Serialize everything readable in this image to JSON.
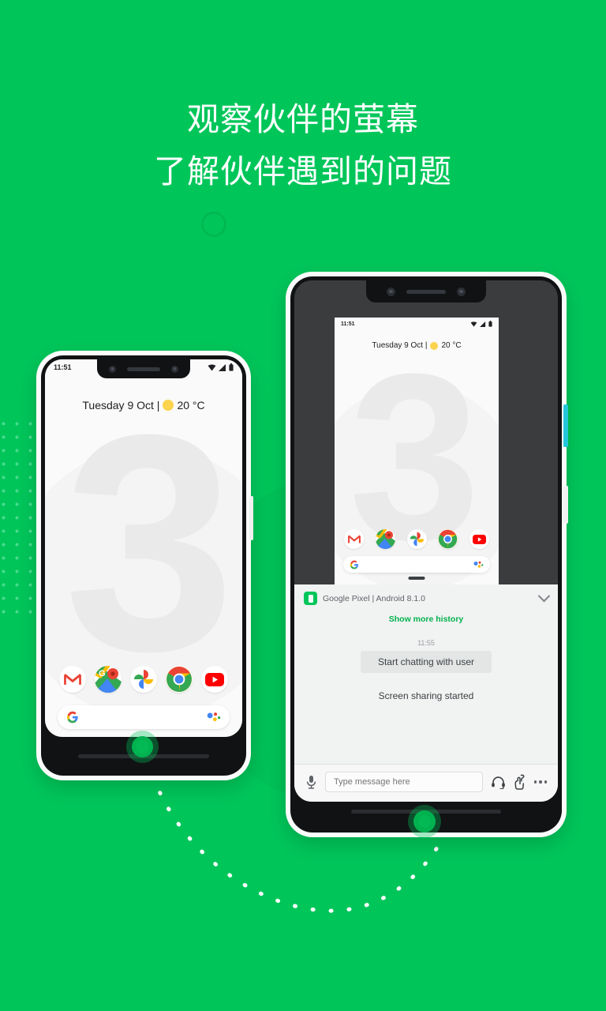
{
  "theme": {
    "background": "#00c65a",
    "accent_green": "#00b24d",
    "headline_color": "#ffffff",
    "phone_body": "#fbfbfb",
    "screen_bg": "#fafafa",
    "dark_screen": "#3a3c3e"
  },
  "headline": {
    "line1": "观察伙伴的萤幕",
    "line2": "了解伙伴遇到的问题",
    "full": "观察伙伴的萤幕\n了解伙伴遇到的问题"
  },
  "left_phone": {
    "label": "user-device",
    "status_bar": {
      "time": "11:51",
      "icons": [
        "wifi-icon",
        "signal-icon",
        "battery-icon"
      ]
    },
    "home": {
      "date_weather": "Tuesday 9 Oct |",
      "temperature": "20 °C",
      "weather_icon": "sun-icon",
      "wallpaper_glyph": "3"
    },
    "dock": [
      {
        "name": "gmail",
        "label": "Gmail"
      },
      {
        "name": "maps",
        "label": "Maps"
      },
      {
        "name": "photos",
        "label": "Photos"
      },
      {
        "name": "chrome",
        "label": "Chrome"
      },
      {
        "name": "youtube",
        "label": "YouTube"
      }
    ],
    "search_bar": {
      "leading_icon": "google-g-icon",
      "trailing_icon": "assistant-icon",
      "value": ""
    }
  },
  "right_phone": {
    "label": "technician-device",
    "mirrored_screen": {
      "status_bar": {
        "time": "11:51",
        "icons": [
          "wifi-icon",
          "signal-icon",
          "battery-icon"
        ]
      },
      "date_weather": "Tuesday 9 Oct |",
      "temperature": "20 °C",
      "wallpaper_glyph": "3",
      "dock": [
        {
          "name": "gmail",
          "label": "Gmail"
        },
        {
          "name": "maps",
          "label": "Maps"
        },
        {
          "name": "photos",
          "label": "Photos"
        },
        {
          "name": "chrome",
          "label": "Chrome"
        },
        {
          "name": "youtube",
          "label": "YouTube"
        }
      ],
      "search_bar": {
        "leading_icon": "google-g-icon",
        "trailing_icon": "assistant-icon"
      }
    },
    "chat_panel": {
      "device_title": "Google Pixel | Android 8.1.0",
      "device_icon": "phone-icon",
      "collapse_icon": "chevron-down-icon",
      "show_more_label": "Show more history",
      "message_time": "11:55",
      "message_bubble": "Start chatting with user",
      "status_message": "Screen sharing started"
    },
    "composer": {
      "mic_icon": "microphone-icon",
      "input_placeholder": "Type message here",
      "input_value": "",
      "headset_icon": "headset-icon",
      "gesture_icon": "pointer-hand-icon",
      "more_icon": "more-horizontal-icon"
    }
  },
  "decorations": {
    "ring": "circle-outline",
    "dot_grid": "dot-grid-pattern",
    "connection_path": "dotted-arc",
    "connection_markers": [
      "screen-share-marker-left",
      "screen-share-marker-right"
    ]
  }
}
